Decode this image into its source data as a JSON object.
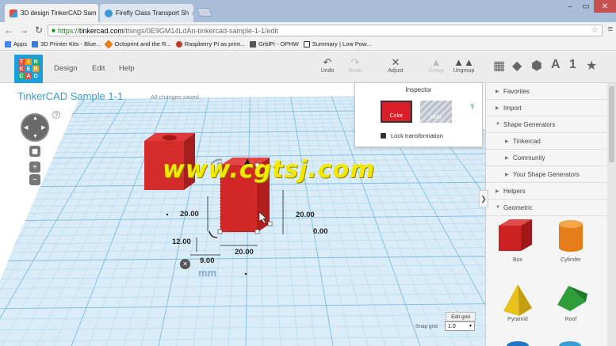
{
  "browser": {
    "tabs": [
      {
        "title": "3D design TinkerCAD Sam",
        "active": true
      },
      {
        "title": "Firefly Class Transport Sh",
        "active": false
      }
    ],
    "url_https": "https://",
    "url_host": "tinkercad.com",
    "url_path": "/things/0E9GM14LdAn-tinkercad-sample-1-1/edit",
    "bookmarks": [
      {
        "label": "Apps",
        "icon_color": "#4285f4"
      },
      {
        "label": "3D Printer Kits - Blue...",
        "icon_color": "#3b7bd4"
      },
      {
        "label": "Octoprint and the R...",
        "icon_color": "#e67e22"
      },
      {
        "label": "Raspberry Pi as print...",
        "icon_color": "#c0392b"
      },
      {
        "label": "GrblPi - OPHW",
        "icon_color": "#555555"
      },
      {
        "label": "Summary | Low Pow...",
        "icon_color": "#333333"
      }
    ]
  },
  "app": {
    "logo_letters": [
      "T",
      "I",
      "N",
      "K",
      "E",
      "R",
      "C",
      "A",
      "D"
    ],
    "menu": {
      "design": "Design",
      "edit": "Edit",
      "help": "Help"
    },
    "tools": {
      "undo": "Undo",
      "redo": "Redo",
      "adjust": "Adjust",
      "group": "Group",
      "ungroup": "Ungroup"
    },
    "view_letter": "A",
    "view_number": "1",
    "title": "TinkerCAD Sample 1-1",
    "save_status": "All changes saved",
    "help_mark": "?"
  },
  "inspector": {
    "title": "Inspector",
    "help": "?",
    "color_label": "Color",
    "hole_label": "Hole",
    "lock_label": "Lock transformation",
    "selected_color": "#d91e2a"
  },
  "dimensions": {
    "height_left": "20.00",
    "height_right": "20.00",
    "elevation": "0.00",
    "width_depth": "12.00",
    "length": "20.00",
    "offset": "9.00",
    "unit": "mm"
  },
  "watermark": "www.cgtsj.com",
  "grid": {
    "edit_label": "Edit grid",
    "snap_label": "Snap grid",
    "snap_value": "1.0"
  },
  "panel": {
    "rows": [
      {
        "label": "Favorites",
        "sub": false
      },
      {
        "label": "Import",
        "sub": false
      },
      {
        "label": "Shape Generators",
        "sub": false
      },
      {
        "label": "Tinkercad",
        "sub": true
      },
      {
        "label": "Community",
        "sub": true
      },
      {
        "label": "Your Shape Generators",
        "sub": true
      },
      {
        "label": "Helpers",
        "sub": false
      },
      {
        "label": "Geometric",
        "sub": false
      }
    ],
    "shapes": {
      "box": "Box",
      "cylinder": "Cylinder",
      "pyramid": "Pyramid",
      "roof": "Roof"
    }
  }
}
